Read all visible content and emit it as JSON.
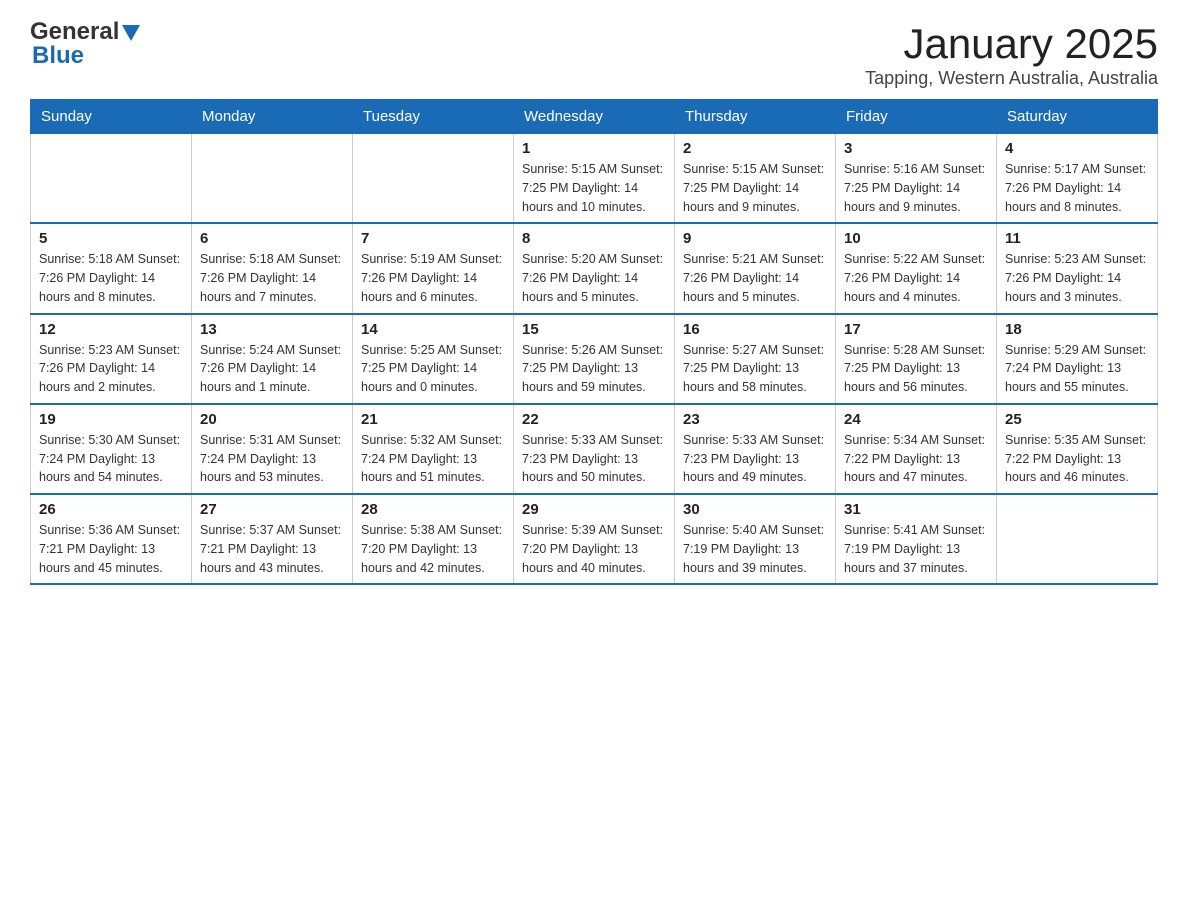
{
  "logo": {
    "general": "General",
    "blue": "Blue"
  },
  "title": "January 2025",
  "subtitle": "Tapping, Western Australia, Australia",
  "weekdays": [
    "Sunday",
    "Monday",
    "Tuesday",
    "Wednesday",
    "Thursday",
    "Friday",
    "Saturday"
  ],
  "weeks": [
    [
      {
        "day": "",
        "info": ""
      },
      {
        "day": "",
        "info": ""
      },
      {
        "day": "",
        "info": ""
      },
      {
        "day": "1",
        "info": "Sunrise: 5:15 AM\nSunset: 7:25 PM\nDaylight: 14 hours\nand 10 minutes."
      },
      {
        "day": "2",
        "info": "Sunrise: 5:15 AM\nSunset: 7:25 PM\nDaylight: 14 hours\nand 9 minutes."
      },
      {
        "day": "3",
        "info": "Sunrise: 5:16 AM\nSunset: 7:25 PM\nDaylight: 14 hours\nand 9 minutes."
      },
      {
        "day": "4",
        "info": "Sunrise: 5:17 AM\nSunset: 7:26 PM\nDaylight: 14 hours\nand 8 minutes."
      }
    ],
    [
      {
        "day": "5",
        "info": "Sunrise: 5:18 AM\nSunset: 7:26 PM\nDaylight: 14 hours\nand 8 minutes."
      },
      {
        "day": "6",
        "info": "Sunrise: 5:18 AM\nSunset: 7:26 PM\nDaylight: 14 hours\nand 7 minutes."
      },
      {
        "day": "7",
        "info": "Sunrise: 5:19 AM\nSunset: 7:26 PM\nDaylight: 14 hours\nand 6 minutes."
      },
      {
        "day": "8",
        "info": "Sunrise: 5:20 AM\nSunset: 7:26 PM\nDaylight: 14 hours\nand 5 minutes."
      },
      {
        "day": "9",
        "info": "Sunrise: 5:21 AM\nSunset: 7:26 PM\nDaylight: 14 hours\nand 5 minutes."
      },
      {
        "day": "10",
        "info": "Sunrise: 5:22 AM\nSunset: 7:26 PM\nDaylight: 14 hours\nand 4 minutes."
      },
      {
        "day": "11",
        "info": "Sunrise: 5:23 AM\nSunset: 7:26 PM\nDaylight: 14 hours\nand 3 minutes."
      }
    ],
    [
      {
        "day": "12",
        "info": "Sunrise: 5:23 AM\nSunset: 7:26 PM\nDaylight: 14 hours\nand 2 minutes."
      },
      {
        "day": "13",
        "info": "Sunrise: 5:24 AM\nSunset: 7:26 PM\nDaylight: 14 hours\nand 1 minute."
      },
      {
        "day": "14",
        "info": "Sunrise: 5:25 AM\nSunset: 7:25 PM\nDaylight: 14 hours\nand 0 minutes."
      },
      {
        "day": "15",
        "info": "Sunrise: 5:26 AM\nSunset: 7:25 PM\nDaylight: 13 hours\nand 59 minutes."
      },
      {
        "day": "16",
        "info": "Sunrise: 5:27 AM\nSunset: 7:25 PM\nDaylight: 13 hours\nand 58 minutes."
      },
      {
        "day": "17",
        "info": "Sunrise: 5:28 AM\nSunset: 7:25 PM\nDaylight: 13 hours\nand 56 minutes."
      },
      {
        "day": "18",
        "info": "Sunrise: 5:29 AM\nSunset: 7:24 PM\nDaylight: 13 hours\nand 55 minutes."
      }
    ],
    [
      {
        "day": "19",
        "info": "Sunrise: 5:30 AM\nSunset: 7:24 PM\nDaylight: 13 hours\nand 54 minutes."
      },
      {
        "day": "20",
        "info": "Sunrise: 5:31 AM\nSunset: 7:24 PM\nDaylight: 13 hours\nand 53 minutes."
      },
      {
        "day": "21",
        "info": "Sunrise: 5:32 AM\nSunset: 7:24 PM\nDaylight: 13 hours\nand 51 minutes."
      },
      {
        "day": "22",
        "info": "Sunrise: 5:33 AM\nSunset: 7:23 PM\nDaylight: 13 hours\nand 50 minutes."
      },
      {
        "day": "23",
        "info": "Sunrise: 5:33 AM\nSunset: 7:23 PM\nDaylight: 13 hours\nand 49 minutes."
      },
      {
        "day": "24",
        "info": "Sunrise: 5:34 AM\nSunset: 7:22 PM\nDaylight: 13 hours\nand 47 minutes."
      },
      {
        "day": "25",
        "info": "Sunrise: 5:35 AM\nSunset: 7:22 PM\nDaylight: 13 hours\nand 46 minutes."
      }
    ],
    [
      {
        "day": "26",
        "info": "Sunrise: 5:36 AM\nSunset: 7:21 PM\nDaylight: 13 hours\nand 45 minutes."
      },
      {
        "day": "27",
        "info": "Sunrise: 5:37 AM\nSunset: 7:21 PM\nDaylight: 13 hours\nand 43 minutes."
      },
      {
        "day": "28",
        "info": "Sunrise: 5:38 AM\nSunset: 7:20 PM\nDaylight: 13 hours\nand 42 minutes."
      },
      {
        "day": "29",
        "info": "Sunrise: 5:39 AM\nSunset: 7:20 PM\nDaylight: 13 hours\nand 40 minutes."
      },
      {
        "day": "30",
        "info": "Sunrise: 5:40 AM\nSunset: 7:19 PM\nDaylight: 13 hours\nand 39 minutes."
      },
      {
        "day": "31",
        "info": "Sunrise: 5:41 AM\nSunset: 7:19 PM\nDaylight: 13 hours\nand 37 minutes."
      },
      {
        "day": "",
        "info": ""
      }
    ]
  ]
}
